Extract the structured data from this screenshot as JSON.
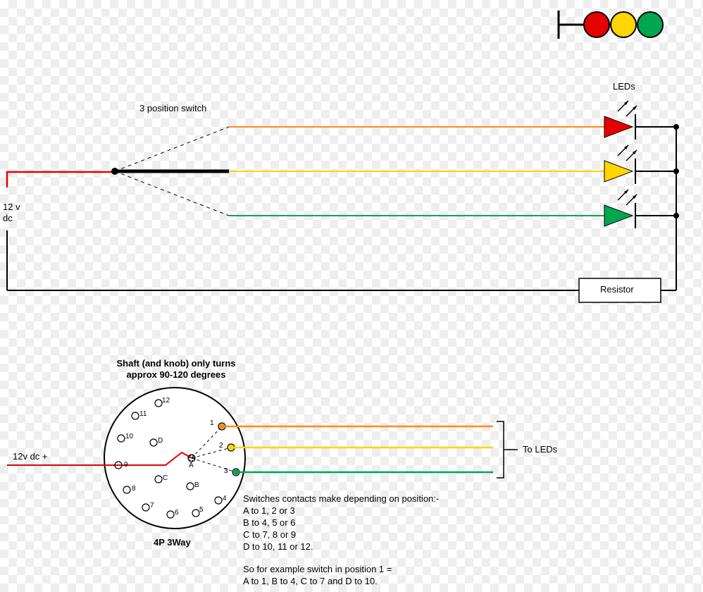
{
  "top": {
    "switch_label": "3 position switch",
    "leds_label": "LEDs",
    "voltage_line1": "12 v",
    "voltage_line2": "dc",
    "resistor_label": "Resistor"
  },
  "bottom": {
    "shaft_line1": "Shaft (and knob) only turns",
    "shaft_line2": "approx 90-120 degrees",
    "voltage_in": "12v dc +",
    "to_leds": "To LEDs",
    "switch_type": "4P 3Way",
    "contacts_heading": "Switches contacts make depending on position:-",
    "contacts_a": "A to 1, 2 or 3",
    "contacts_b": "B to 4, 5 or 6",
    "contacts_c": "C to 7, 8 or 9",
    "contacts_d": "D to 10, 11 or 12.",
    "example_line1": "So for example switch in position 1 =",
    "example_line2": "A to 1, B to 4, C to 7 and D to 10.",
    "terminals": {
      "t1": "1",
      "t2": "2",
      "t3": "3",
      "t4": "4",
      "t5": "5",
      "t6": "6",
      "t7": "7",
      "t8": "8",
      "t9": "9",
      "t10": "10",
      "t11": "11",
      "t12": "12",
      "a": "A",
      "b": "B",
      "c": "C",
      "d": "D"
    }
  },
  "colors": {
    "red": "#e60000",
    "orange": "#ff8c1a",
    "yellow": "#ffd500",
    "green": "#00a650",
    "black": "#000000"
  }
}
